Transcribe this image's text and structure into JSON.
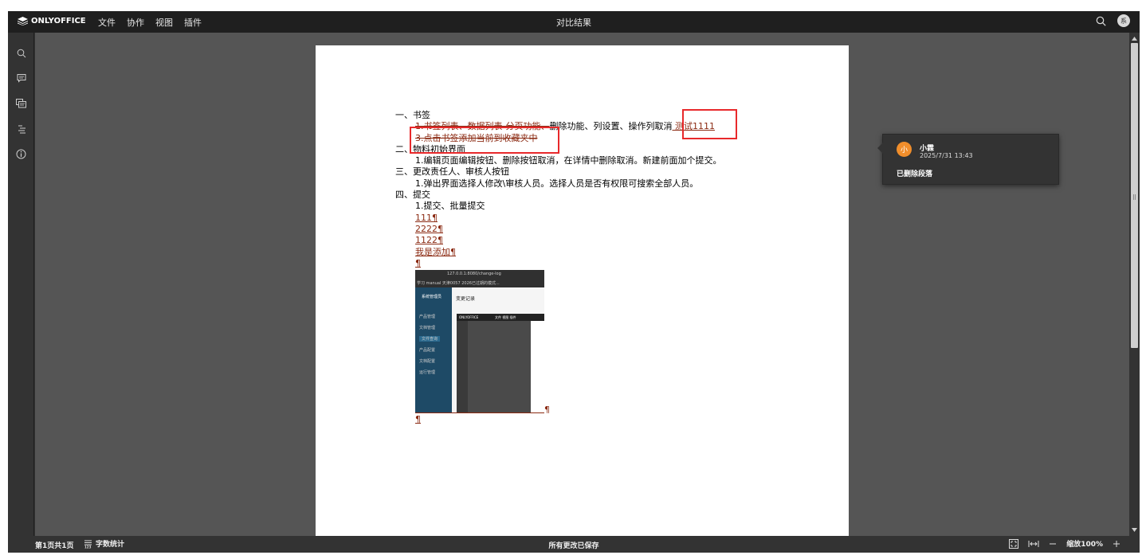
{
  "topbar": {
    "logo_text": "ONLYOFFICE",
    "menu": [
      {
        "label": "文件"
      },
      {
        "label": "协作"
      },
      {
        "label": "视图"
      },
      {
        "label": "插件"
      }
    ],
    "document_title": "对比结果",
    "user_initial": "系"
  },
  "sidebar": {
    "items": [
      "search-icon",
      "comment-icon",
      "chat-icon",
      "navigation-icon",
      "info-icon"
    ]
  },
  "document": {
    "lines": [
      {
        "text": "一、书签",
        "indent": false
      },
      {
        "text": "二、物料初始界面",
        "indent": false
      },
      {
        "text": "1.编辑页面编辑按钮、删除按钮取消，在详情中删除取消。新建前面加个提交。",
        "indent": true
      },
      {
        "text": "三、更改责任人、审核人按钮",
        "indent": false
      },
      {
        "text": "1.弹出界面选择人修改\\审核人员。选择人员是否有权限可搜索全部人员。",
        "indent": true
      },
      {
        "text": "四、提交",
        "indent": false
      },
      {
        "text": "1.提交、批量提交",
        "indent": true
      }
    ],
    "line1_deleted": "1.书签列表、数据列表-分页功能、",
    "line1_normal": "删除功能、列设置、操作列取消",
    "line1_inserted": " 测试1111",
    "line2_deleted": "3.点击书签添加当前到收藏夹中",
    "inserted_paragraphs": [
      "111¶",
      "2222¶",
      "1122¶",
      "我是添加¶",
      "¶"
    ],
    "pilcrow": "¶",
    "embedded_image": {
      "top_bar_text": "127.0.0.1:8080/change-log",
      "tabs_text": "学习  manual  天津0057  2026已过期的模式...",
      "sidebar_title": "系统管理员",
      "main_title": "变更记录",
      "sidebar_items": [
        "产品管理",
        "文档管理",
        "文件查询",
        "产品配置",
        "文档配置",
        "运行管理"
      ],
      "oo_logo": "ONLYOFFICE",
      "oo_menu": "文件   视图   插件"
    }
  },
  "comment": {
    "avatar": "小",
    "author": "小霖",
    "date": "2025/7/31 13:43",
    "text": "已删除段落"
  },
  "statusbar": {
    "page_info": "第1页共1页",
    "word_count": "字数统计",
    "save_status": "所有更改已保存",
    "zoom_label": "缩放100%"
  }
}
